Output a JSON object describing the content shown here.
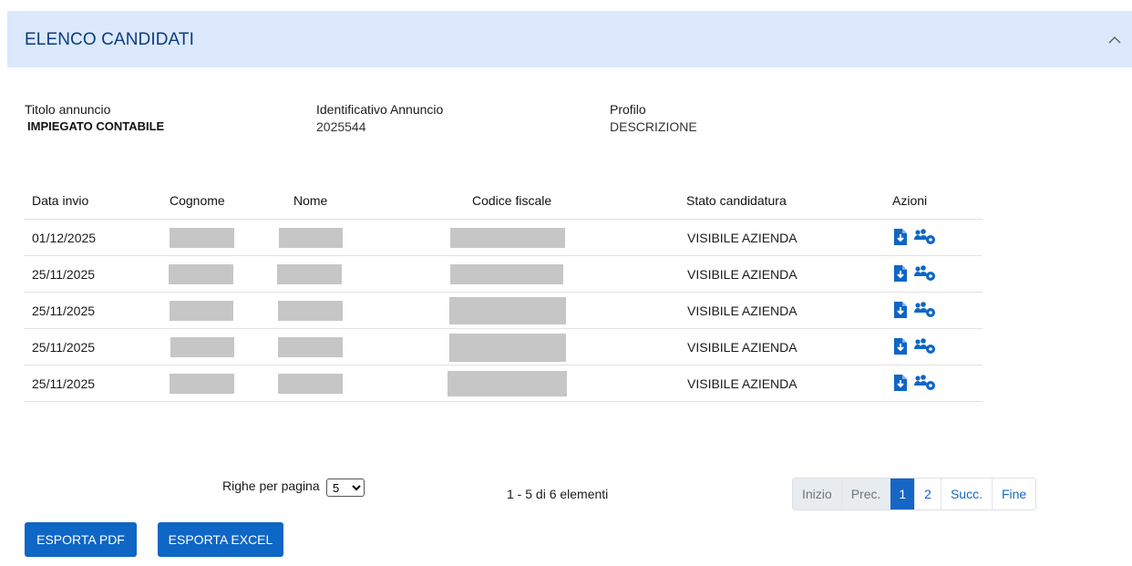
{
  "header": {
    "title": "ELENCO CANDIDATI"
  },
  "info": {
    "titolo_label": "Titolo annuncio",
    "titolo_value": "IMPIEGATO CONTABILE",
    "id_label": "Identificativo Annuncio",
    "id_value": "2025544",
    "profilo_label": "Profilo",
    "profilo_value": "DESCRIZIONE"
  },
  "table": {
    "columns": [
      "Data invio",
      "Cognome",
      "Nome",
      "Codice fiscale",
      "Stato candidatura",
      "Azioni"
    ],
    "rows": [
      {
        "data_invio": "01/12/2025",
        "stato": "VISIBILE AZIENDA"
      },
      {
        "data_invio": "25/11/2025",
        "stato": "VISIBILE AZIENDA"
      },
      {
        "data_invio": "25/11/2025",
        "stato": "VISIBILE AZIENDA"
      },
      {
        "data_invio": "25/11/2025",
        "stato": "VISIBILE AZIENDA"
      },
      {
        "data_invio": "25/11/2025",
        "stato": "VISIBILE AZIENDA"
      }
    ],
    "action_icons": [
      "download-file-icon",
      "users-cog-icon"
    ]
  },
  "pager": {
    "rows_label": "Righe per pagina",
    "rows_selected": "5",
    "summary": "1 - 5 di 6 elementi",
    "buttons": [
      "Inizio",
      "Prec.",
      "1",
      "2",
      "Succ.",
      "Fine"
    ]
  },
  "actions": {
    "pdf": "ESPORTA PDF",
    "excel": "ESPORTA EXCEL"
  },
  "colors": {
    "accent": "#1666c5",
    "header_bg": "#dce8fb",
    "header_text": "#0b3d7e",
    "icon": "#0e66c5"
  }
}
